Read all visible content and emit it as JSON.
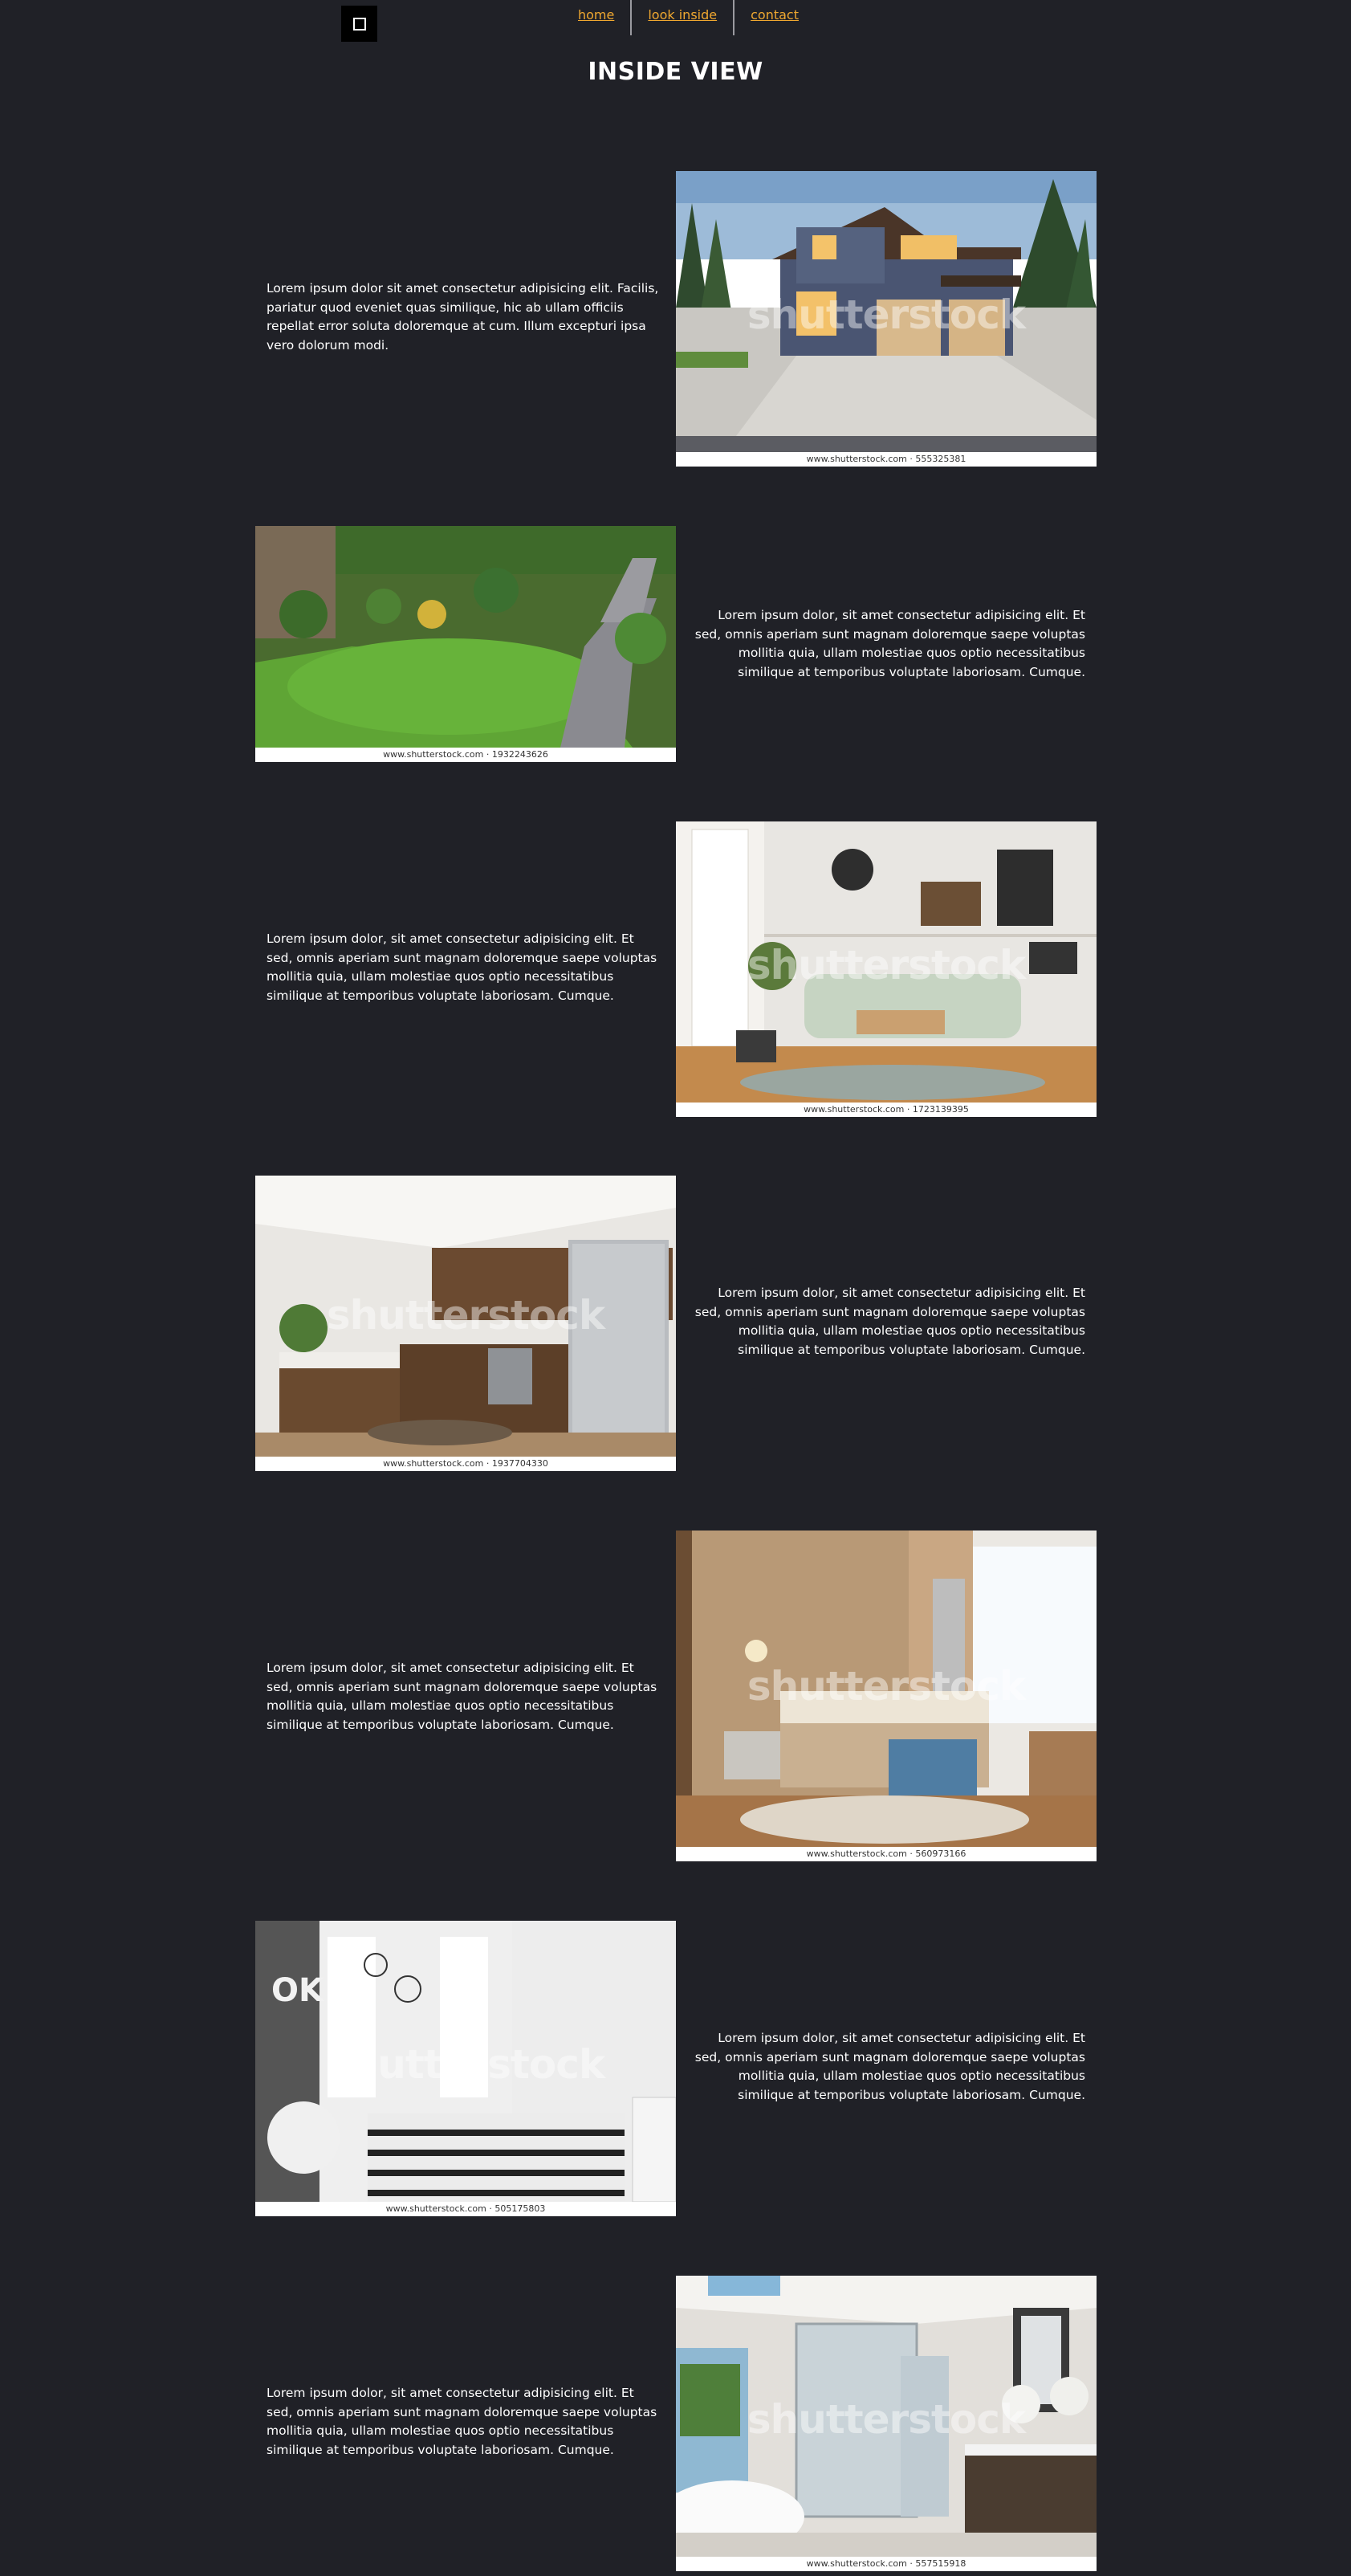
{
  "nav": {
    "links": [
      "home",
      "look inside",
      "contact"
    ]
  },
  "page_title": "INSIDE VIEW",
  "watermark": "shutterstock",
  "sections": [
    {
      "text": "Lorem ipsum dolor sit amet consectetur adipisicing elit. Facilis, pariatur quod eveniet quas similique, hic ab ullam officiis repellat error soluta doloremque at cum. Illum excepturi ipsa vero dolorum modi.",
      "caption": "www.shutterstock.com · 555325381",
      "image": "modern-house-exterior"
    },
    {
      "text": "Lorem ipsum dolor, sit amet consectetur adipisicing elit. Et sed, omnis aperiam sunt magnam doloremque saepe voluptas mollitia quia, ullam molestiae quos optio necessitatibus similique at temporibus voluptate laboriosam. Cumque.",
      "caption": "www.shutterstock.com · 1932243626",
      "image": "garden-lawn"
    },
    {
      "text": "Lorem ipsum dolor, sit amet consectetur adipisicing elit. Et sed, omnis aperiam sunt magnam doloremque saepe voluptas mollitia quia, ullam molestiae quos optio necessitatibus similique at temporibus voluptate laboriosam. Cumque.",
      "caption": "www.shutterstock.com · 1723139395",
      "image": "living-room"
    },
    {
      "text": "Lorem ipsum dolor, sit amet consectetur adipisicing elit. Et sed, omnis aperiam sunt magnam doloremque saepe voluptas mollitia quia, ullam molestiae quos optio necessitatibus similique at temporibus voluptate laboriosam. Cumque.",
      "caption": "www.shutterstock.com · 1937704330",
      "image": "kitchen"
    },
    {
      "text": "Lorem ipsum dolor, sit amet consectetur adipisicing elit. Et sed, omnis aperiam sunt magnam doloremque saepe voluptas mollitia quia, ullam molestiae quos optio necessitatibus similique at temporibus voluptate laboriosam. Cumque.",
      "caption": "www.shutterstock.com · 560973166",
      "image": "bedroom"
    },
    {
      "text": "Lorem ipsum dolor, sit amet consectetur adipisicing elit. Et sed, omnis aperiam sunt magnam doloremque saepe voluptas mollitia quia, ullam molestiae quos optio necessitatibus similique at temporibus voluptate laboriosam. Cumque.",
      "caption": "www.shutterstock.com · 505175803",
      "image": "kids-bedroom"
    },
    {
      "text": "Lorem ipsum dolor, sit amet consectetur adipisicing elit. Et sed, omnis aperiam sunt magnam doloremque saepe voluptas mollitia quia, ullam molestiae quos optio necessitatibus similique at temporibus voluptate laboriosam. Cumque.",
      "caption": "www.shutterstock.com · 557515918",
      "image": "bathroom"
    }
  ]
}
